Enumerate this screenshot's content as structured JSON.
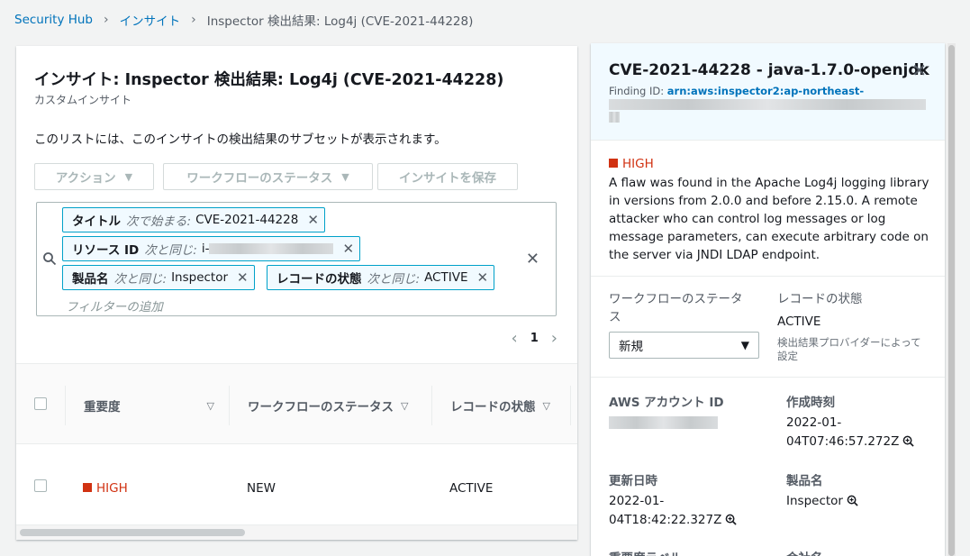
{
  "breadcrumb": {
    "items": [
      "Security Hub",
      "インサイト",
      "Inspector 検出結果: Log4j (CVE-2021-44228)"
    ]
  },
  "insight": {
    "title": "インサイト: Inspector 検出結果: Log4j (CVE-2021-44228)",
    "subtitle": "カスタムインサイト",
    "description": "このリストには、このインサイトの検出結果のサブセットが表示されます。"
  },
  "toolbar": {
    "actions_label": "アクション",
    "workflow_label": "ワークフローのステータス",
    "save_label": "インサイトを保存"
  },
  "filters": {
    "tokens": [
      {
        "key": "タイトル",
        "op": "次で始まる:",
        "value": "CVE-2021-44228"
      },
      {
        "key": "リソース ID",
        "op": "次と同じ:",
        "value": "i-"
      },
      {
        "key": "製品名",
        "op": "次と同じ:",
        "value": "Inspector"
      },
      {
        "key": "レコードの状態",
        "op": "次と同じ:",
        "value": "ACTIVE"
      }
    ],
    "placeholder": "フィルターの追加"
  },
  "pagination": {
    "current": "1"
  },
  "table": {
    "columns": [
      "重要度",
      "ワークフローのステータス",
      "レコードの状態"
    ],
    "rows": [
      {
        "severity": "HIGH",
        "workflow": "NEW",
        "record_state": "ACTIVE"
      }
    ]
  },
  "detail": {
    "title": "CVE-2021-44228 - java-1.7.0-openjdk",
    "finding_id_label": "Finding ID:",
    "finding_id_value": "arn:aws:inspector2:ap-northeast-",
    "severity": "HIGH",
    "description": "A flaw was found in the Apache Log4j logging library in versions from 2.0.0 and before 2.15.0. A remote attacker who can control log messages or log message parameters, can execute arbitrary code on the server via JNDI LDAP endpoint.",
    "workflow_label": "ワークフローのステータス",
    "workflow_value": "新規",
    "record_state_label": "レコードの状態",
    "record_state_value": "ACTIVE",
    "record_state_hint": "検出結果プロバイダーによって設定",
    "account_id_label": "AWS アカウント ID",
    "created_label": "作成時刻",
    "created_value_1": "2022-01-",
    "created_value_2": "04T07:46:57.272Z",
    "updated_label": "更新日時",
    "updated_value_1": "2022-01-",
    "updated_value_2": "04T18:42:22.327Z",
    "product_label": "製品名",
    "product_value": "Inspector",
    "severity_label_cut": "重要度ラベル",
    "company_label_cut": "会社名"
  },
  "colors": {
    "accent": "#0073bb",
    "high": "#d13212",
    "token_border": "#00a1c9"
  }
}
